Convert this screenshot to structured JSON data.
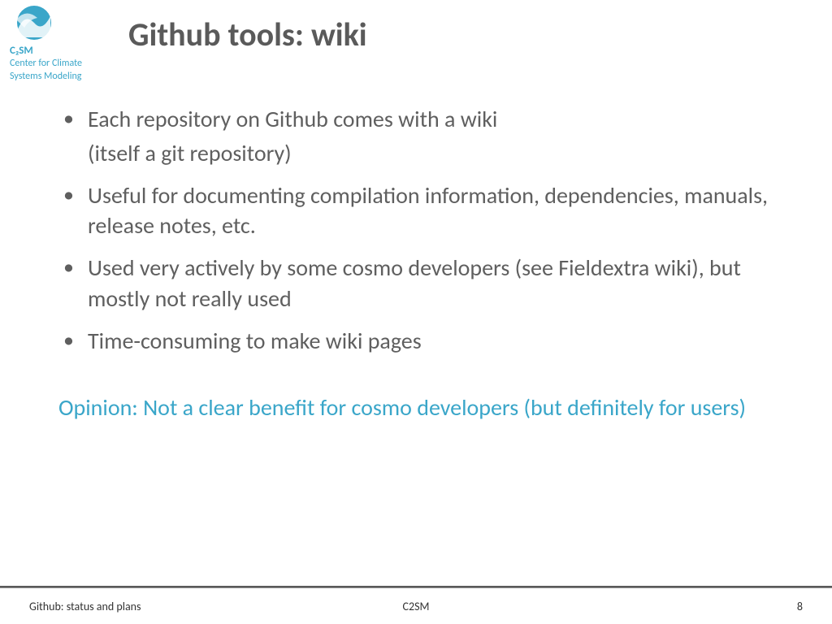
{
  "logo": {
    "acronym": "C₂SM",
    "line1": "Center for Climate",
    "line2": "Systems Modeling"
  },
  "title": "Github tools: wiki",
  "bullets": [
    {
      "text": "Each repository on Github comes with a wiki",
      "sub": "(itself a git repository)"
    },
    {
      "text": "Useful for documenting compilation information, dependencies, manuals, release notes, etc."
    },
    {
      "text": "Used very actively by some cosmo developers (see Fieldextra wiki), but mostly not really used"
    },
    {
      "text": "Time-consuming to make wiki pages"
    }
  ],
  "opinion": "Opinion:  Not a clear benefit for cosmo developers (but definitely for users)",
  "footer": {
    "left": "Github: status and plans",
    "center": "C2SM",
    "page": "8"
  }
}
